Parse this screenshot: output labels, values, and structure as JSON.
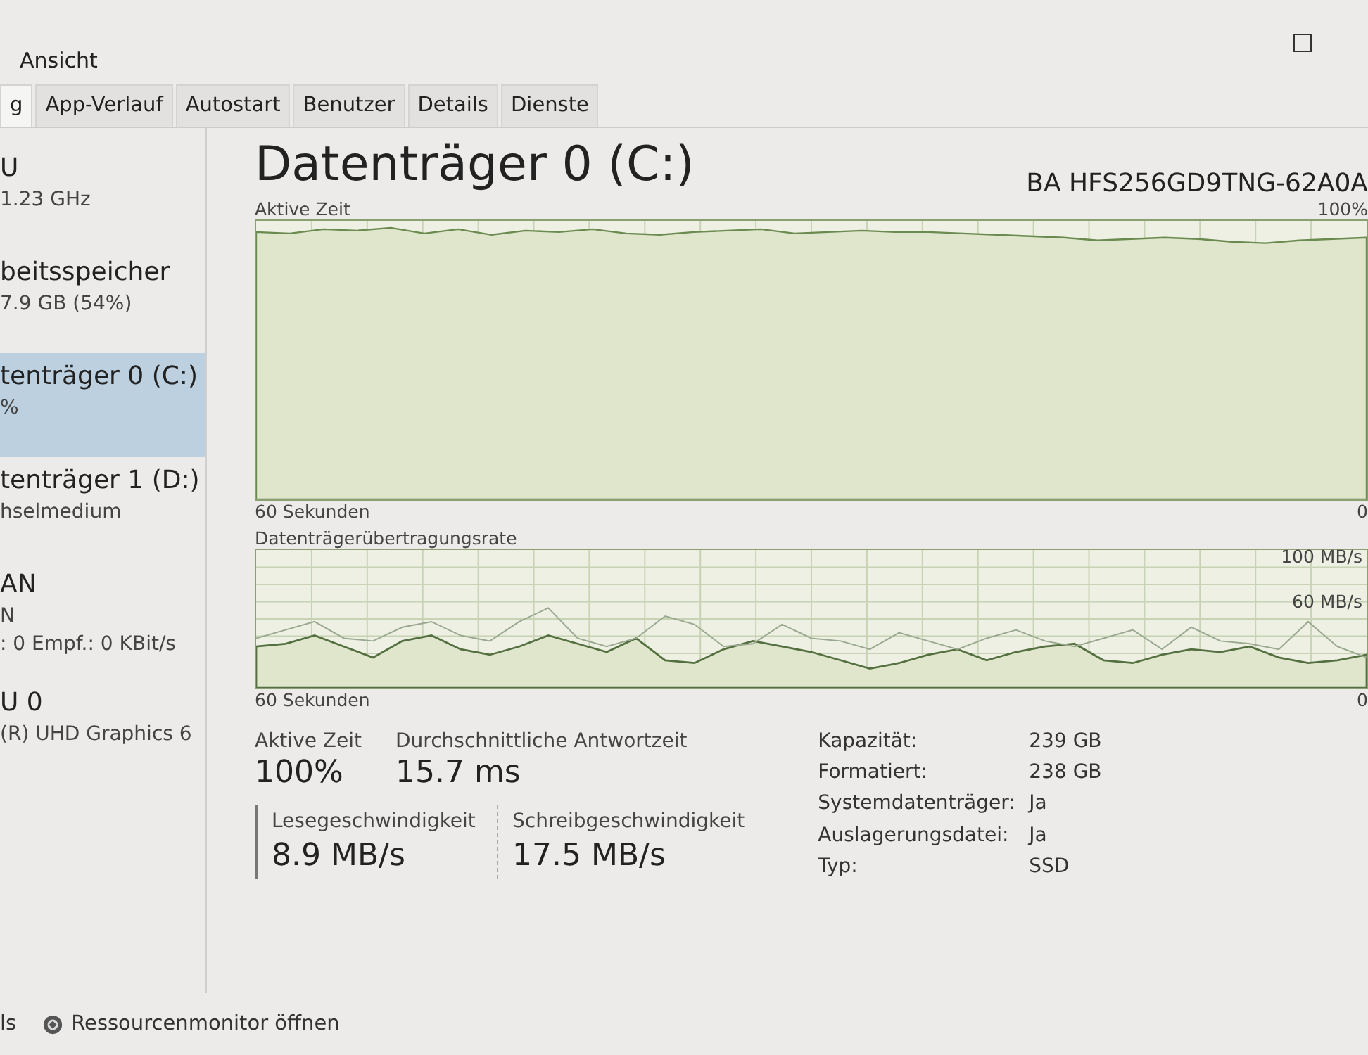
{
  "menu": {
    "items": [
      "Ansicht"
    ]
  },
  "tabs": [
    {
      "label": "g",
      "selected": true
    },
    {
      "label": "App-Verlauf",
      "selected": false
    },
    {
      "label": "Autostart",
      "selected": false
    },
    {
      "label": "Benutzer",
      "selected": false
    },
    {
      "label": "Details",
      "selected": false
    },
    {
      "label": "Dienste",
      "selected": false
    }
  ],
  "sidebar": {
    "items": [
      {
        "title": "U",
        "lines": [
          "1.23 GHz"
        ],
        "selected": false
      },
      {
        "title": "beitsspeicher",
        "lines": [
          "7.9 GB (54%)"
        ],
        "selected": false
      },
      {
        "title": "tenträger 0 (C:)",
        "lines": [
          "%"
        ],
        "selected": true
      },
      {
        "title": "tenträger 1 (D:)",
        "lines": [
          "hselmedium"
        ],
        "selected": false
      },
      {
        "title": "AN",
        "lines": [
          "N",
          ": 0 Empf.: 0 KBit/s"
        ],
        "selected": false
      },
      {
        "title": "U 0",
        "lines": [
          "(R) UHD Graphics 6"
        ],
        "selected": false
      }
    ]
  },
  "header": {
    "title": "Datenträger 0 (C:)",
    "model": "BA HFS256GD9TNG-62A0A"
  },
  "active_time_graph": {
    "label": "Aktive Zeit",
    "max": "100%",
    "time_span": "60 Sekunden",
    "min": "0"
  },
  "transfer_graph": {
    "label": "Datenträgerübertragungsrate",
    "max": "100 MB/s",
    "mid": "60 MB/s",
    "time_span": "60 Sekunden",
    "min": "0"
  },
  "stats": [
    {
      "label": "Aktive Zeit",
      "value": "100%"
    },
    {
      "label": "Durchschnittliche Antwortzeit",
      "value": "15.7 ms"
    }
  ],
  "speeds": [
    {
      "label": "Lesegeschwindigkeit",
      "value": "8.9 MB/s"
    },
    {
      "label": "Schreibgeschwindigkeit",
      "value": "17.5 MB/s"
    }
  ],
  "properties": [
    {
      "label": "Kapazität:",
      "value": "239 GB"
    },
    {
      "label": "Formatiert:",
      "value": "238 GB"
    },
    {
      "label": "Systemdatenträger:",
      "value": "Ja"
    },
    {
      "label": "Auslagerungsdatei:",
      "value": "Ja"
    },
    {
      "label": "Typ:",
      "value": "SSD"
    }
  ],
  "footer": {
    "details_toggle": "ls",
    "resource_monitor_link": "Ressourcenmonitor öffnen"
  }
}
